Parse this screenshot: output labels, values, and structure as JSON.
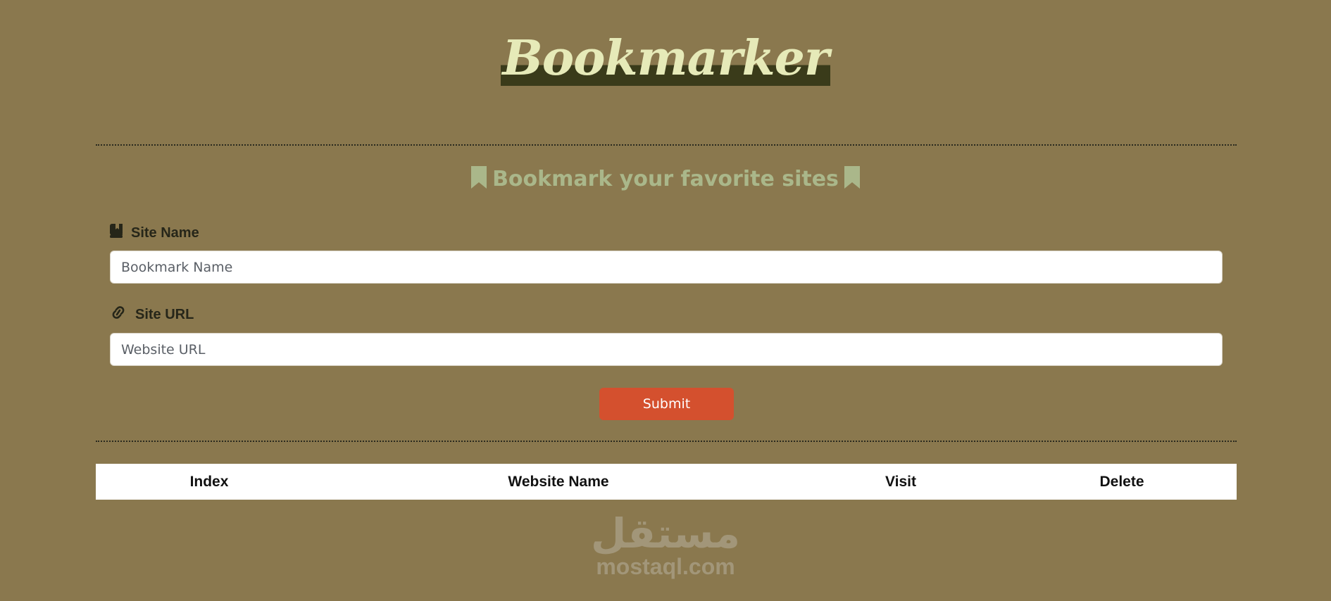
{
  "header": {
    "title": "Bookmarker"
  },
  "form": {
    "subtitle": "Bookmark your favorite sites",
    "site_name_label": "Site Name",
    "site_name_placeholder": "Bookmark Name",
    "site_name_value": "",
    "site_url_label": "Site URL",
    "site_url_placeholder": "Website URL",
    "site_url_value": "",
    "submit_label": "Submit"
  },
  "table": {
    "columns": [
      "Index",
      "Website Name",
      "Visit",
      "Delete"
    ],
    "rows": []
  },
  "watermark": {
    "arabic": "مستقل",
    "latin": "mostaql.com"
  },
  "icons": {
    "subtitle_left": "bookmark-icon",
    "subtitle_right": "bookmark-icon",
    "site_name": "book-bookmark-icon",
    "site_url": "link-icon"
  },
  "colors": {
    "background": "#8a784e",
    "title": "#e6eab8",
    "title_highlight": "#3a3b1a",
    "subtitle": "#aab78a",
    "submit": "#d4502e"
  }
}
